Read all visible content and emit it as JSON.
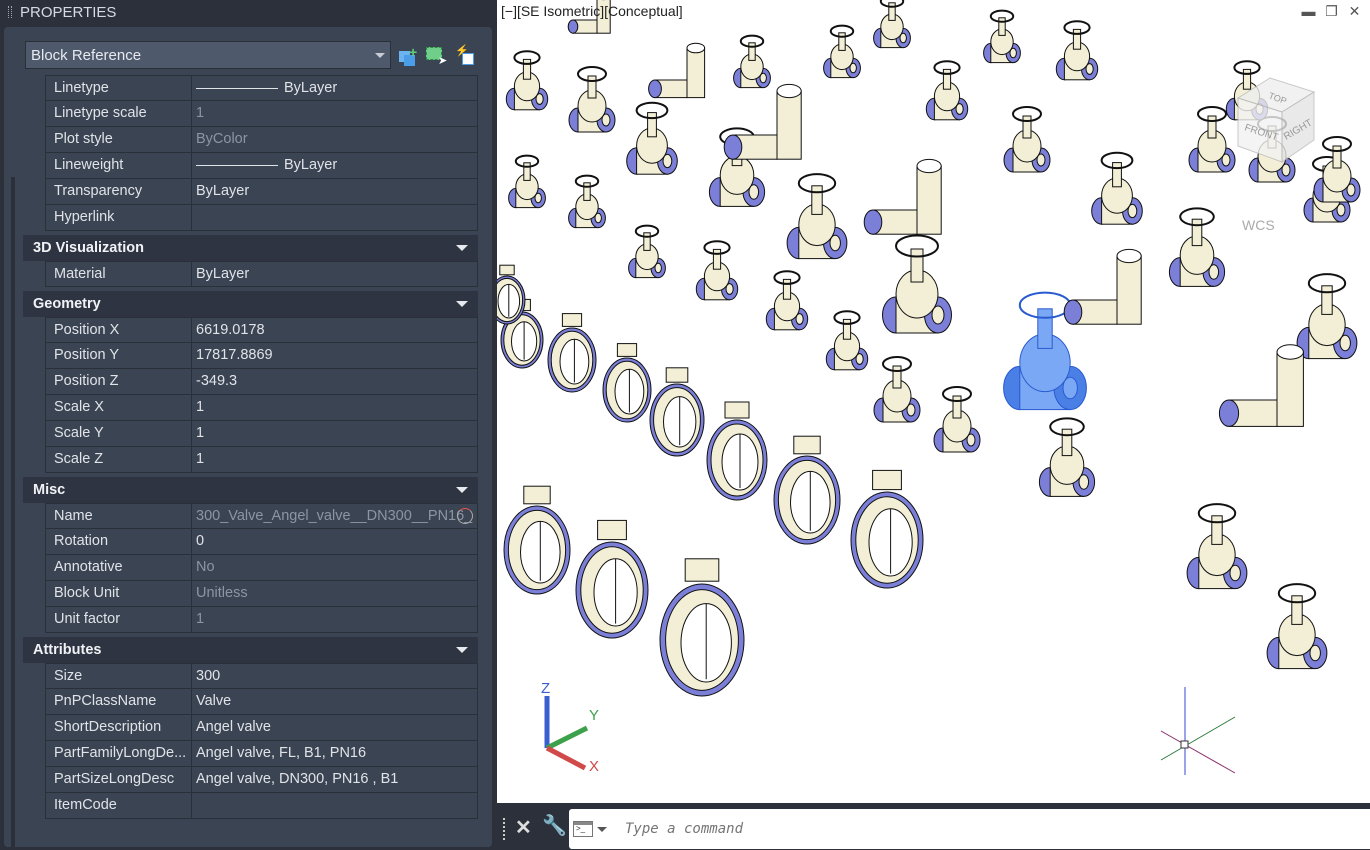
{
  "palette": {
    "title": "PROPERTIES",
    "object_type": "Block Reference"
  },
  "general": [
    {
      "label": "Linetype",
      "value": "ByLayer",
      "line": true
    },
    {
      "label": "Linetype scale",
      "value": "1",
      "dim": true
    },
    {
      "label": "Plot style",
      "value": "ByColor",
      "dim": true
    },
    {
      "label": "Lineweight",
      "value": "ByLayer",
      "line": true
    },
    {
      "label": "Transparency",
      "value": "ByLayer"
    },
    {
      "label": "Hyperlink",
      "value": ""
    }
  ],
  "sections": [
    {
      "title": "3D Visualization",
      "rows": [
        {
          "label": "Material",
          "value": "ByLayer"
        }
      ]
    },
    {
      "title": "Geometry",
      "rows": [
        {
          "label": "Position X",
          "value": "6619.0178"
        },
        {
          "label": "Position Y",
          "value": "17817.8869"
        },
        {
          "label": "Position Z",
          "value": "-349.3"
        },
        {
          "label": "Scale X",
          "value": "1"
        },
        {
          "label": "Scale Y",
          "value": "1"
        },
        {
          "label": "Scale Z",
          "value": "1"
        }
      ]
    },
    {
      "title": "Misc",
      "rows": [
        {
          "label": "Name",
          "value": "300_Valve_Angel_valve__DN300__PN16_",
          "dim": true
        },
        {
          "label": "Rotation",
          "value": "0"
        },
        {
          "label": "Annotative",
          "value": "No",
          "dim": true
        },
        {
          "label": "Block Unit",
          "value": "Unitless",
          "dim": true
        },
        {
          "label": "Unit factor",
          "value": "1",
          "dim": true
        }
      ]
    },
    {
      "title": "Attributes",
      "rows": [
        {
          "label": "Size",
          "value": "300"
        },
        {
          "label": "PnPClassName",
          "value": "Valve"
        },
        {
          "label": "ShortDescription",
          "value": "Angel valve"
        },
        {
          "label": "PartFamilyLongDe...",
          "value": "Angel valve, FL, B1, PN16"
        },
        {
          "label": "PartSizeLongDesc",
          "value": "Angel valve, DN300, PN16 , B1"
        },
        {
          "label": "ItemCode",
          "value": ""
        }
      ]
    }
  ],
  "viewport": {
    "label": "[−][SE Isometric][Conceptual]",
    "viewcube": {
      "top": "TOP",
      "front": "FRONT",
      "right": "RIGHT"
    },
    "ucs": "WCS",
    "axis": {
      "x": "X",
      "y": "Y",
      "z": "Z"
    }
  },
  "command": {
    "placeholder": "Type a command"
  },
  "colors": {
    "selected": "#4a7fe6",
    "valve_body": "#f2efd6",
    "valve_shade": "#7b7fd8"
  }
}
